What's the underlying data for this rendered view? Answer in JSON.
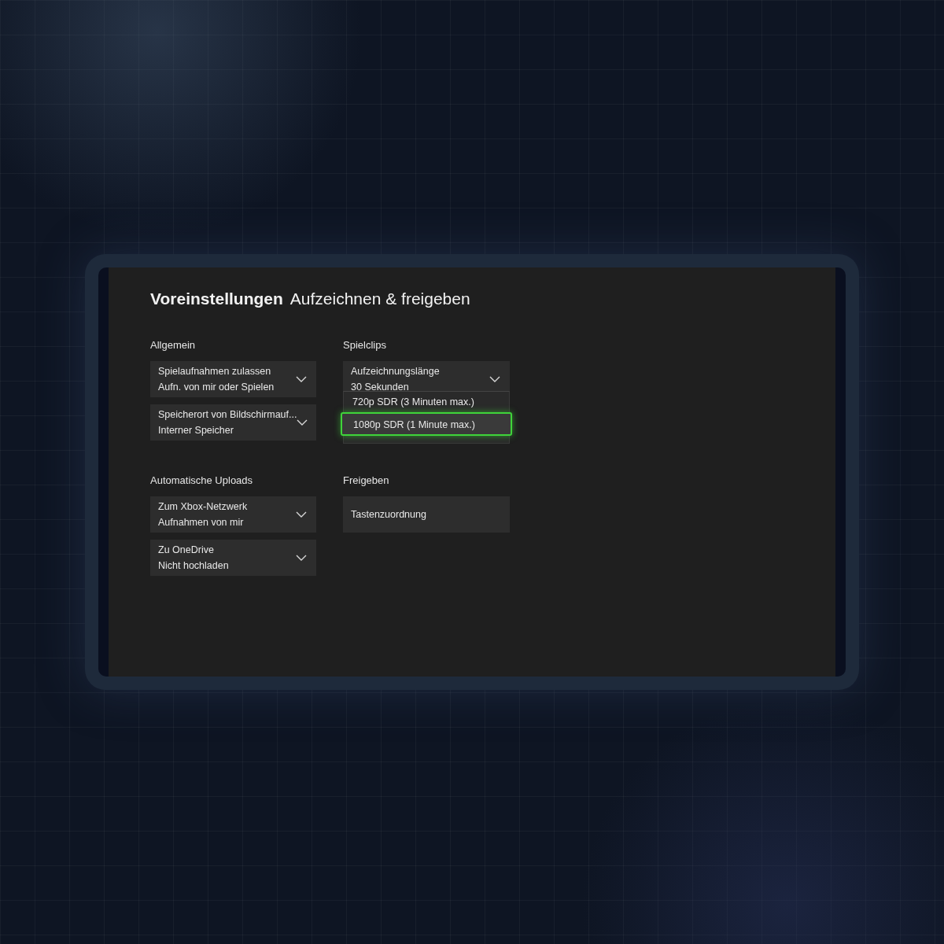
{
  "title": {
    "bold": "Voreinstellungen",
    "rest": "Aufzeichnen & freigeben"
  },
  "sections": [
    {
      "heading": "Allgemein",
      "items": [
        {
          "kind": "dropdown",
          "label": "Spielaufnahmen zulassen",
          "value": "Aufn. von mir oder Spielen",
          "expanded": false
        },
        {
          "kind": "dropdown",
          "label": "Speicherort von Bildschirmauf...",
          "value": "Interner Speicher",
          "expanded": false
        }
      ]
    },
    {
      "heading": "Spielclips",
      "items": [
        {
          "kind": "dropdown",
          "label": "Aufzeichnungslänge",
          "value": "30 Sekunden",
          "expanded": true,
          "options": [
            {
              "label": "720p SDR (3 Minuten max.)",
              "selected": false
            },
            {
              "label": "1080p SDR (1 Minute max.)",
              "selected": true
            }
          ]
        }
      ]
    },
    {
      "heading": "Automatische Uploads",
      "items": [
        {
          "kind": "dropdown",
          "label": "Zum Xbox-Netzwerk",
          "value": "Aufnahmen von mir",
          "expanded": false
        },
        {
          "kind": "dropdown",
          "label": "Zu OneDrive",
          "value": "Nicht hochladen",
          "expanded": false
        }
      ]
    },
    {
      "heading": "Freigeben",
      "items": [
        {
          "kind": "button",
          "label": "Tastenzuordnung"
        }
      ]
    }
  ]
}
